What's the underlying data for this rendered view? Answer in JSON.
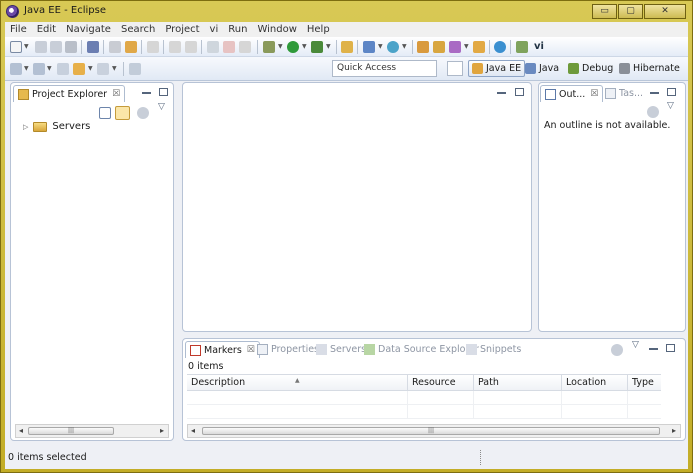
{
  "window": {
    "title": "Java EE - Eclipse",
    "controls": {
      "minimize": "▭",
      "maximize": "▢",
      "close": "✕"
    }
  },
  "menu": [
    "File",
    "Edit",
    "Navigate",
    "Search",
    "Project",
    "vi",
    "Run",
    "Window",
    "Help"
  ],
  "toolbar": {
    "quick_access_placeholder": "Quick Access",
    "perspectives": [
      {
        "label": "Java EE",
        "active": true
      },
      {
        "label": "Java",
        "active": false
      },
      {
        "label": "Debug",
        "active": false
      },
      {
        "label": "Hibernate",
        "active": false
      }
    ]
  },
  "project_explorer": {
    "tab_label": "Project Explorer",
    "tab_close": "☒",
    "tree": [
      {
        "label": "Servers",
        "expandable": true
      }
    ],
    "scroll_thumb": "|||"
  },
  "outline": {
    "tab_label": "Out...",
    "tab_close": "☒",
    "second_tab": "Tas...",
    "message": "An outline is not available."
  },
  "bottom_panel": {
    "tabs": [
      {
        "label": "Markers",
        "active": true,
        "close": "☒"
      },
      {
        "label": "Properties",
        "active": false
      },
      {
        "label": "Servers",
        "active": false
      },
      {
        "label": "Data Source Explorer",
        "active": false
      },
      {
        "label": "Snippets",
        "active": false
      }
    ],
    "items_count": "0 items",
    "columns": [
      "Description",
      "Resource",
      "Path",
      "Location",
      "Type"
    ],
    "scroll_thumb": "|||"
  },
  "status": {
    "text": "0 items selected"
  },
  "colors": {
    "accent": "#c9b63a",
    "panel_border": "#b7c3d6"
  }
}
